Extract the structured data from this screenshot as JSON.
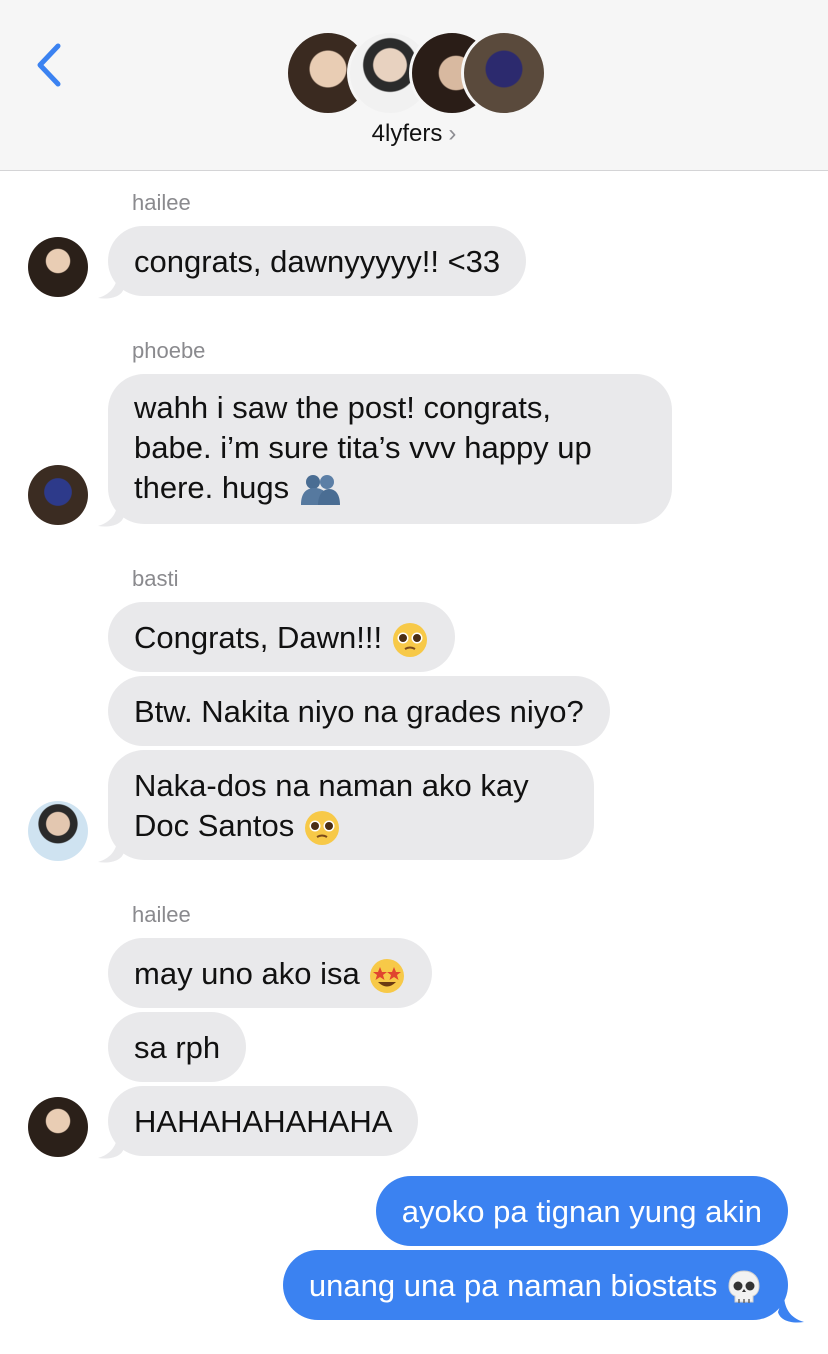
{
  "header": {
    "back_icon": "chevron-left-icon",
    "group_name": "4lyfers",
    "chevron": "›"
  },
  "messages": {
    "s1": "hailee",
    "m1": "congrats, dawnyyyyy!! <33",
    "s2": "phoebe",
    "m2_l1": "wahh i saw the post! congrats,",
    "m2_l2": "babe. i’m sure tita’s vvv happy up",
    "m2_l3": "there. hugs",
    "s3": "basti",
    "m3": "Congrats, Dawn!!!",
    "m4": "Btw. Nakita niyo na grades niyo?",
    "m5_l1": "Naka-dos na naman ako kay",
    "m5_l2": "Doc Santos",
    "s4": "hailee",
    "m6": "may uno ako isa",
    "m7": "sa rph",
    "m8": "HAHAHAHAHAHA",
    "m9": "ayoko pa tignan yung akin",
    "m10": "unang una pa naman biostats"
  },
  "colors": {
    "accent": "#3b82f1",
    "incoming_bubble": "#e9e9eb",
    "header_bg": "#f6f6f6"
  },
  "icons": [
    "chevron-left-icon",
    "people-hugging-emoji",
    "pleading-face-emoji",
    "star-struck-emoji",
    "skull-emoji"
  ]
}
